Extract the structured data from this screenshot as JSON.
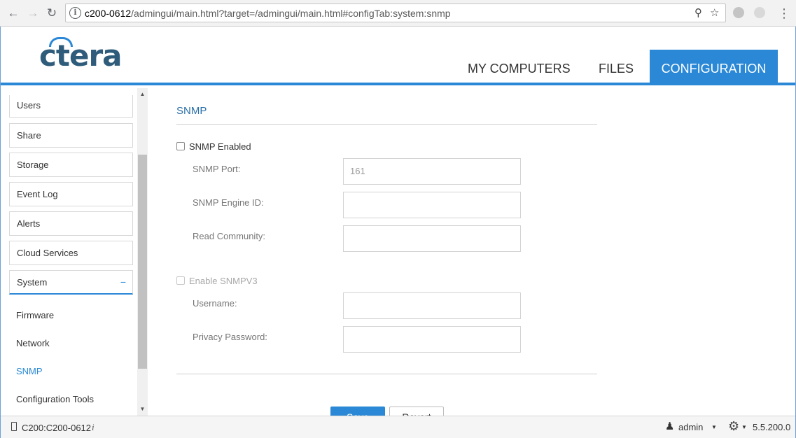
{
  "browser": {
    "url_host": "c200-0612",
    "url_path": "/admingui/main.html?target=/admingui/main.html#configTab:system:snmp"
  },
  "app": {
    "logo_text": "ctera",
    "tabs": [
      "MY COMPUTERS",
      "FILES",
      "CONFIGURATION"
    ],
    "active_tab": "CONFIGURATION",
    "accent_color": "#2a88d6"
  },
  "sidebar": {
    "items": [
      "Users",
      "Share",
      "Storage",
      "Event Log",
      "Alerts",
      "Cloud Services",
      "System"
    ],
    "system_collapse": "−",
    "sub_items": [
      "Firmware",
      "Network",
      "SNMP",
      "Configuration Tools"
    ],
    "active_sub": "SNMP"
  },
  "content": {
    "title": "SNMP",
    "snmp_enabled_label": "SNMP Enabled",
    "snmp_port_label": "SNMP Port:",
    "snmp_port_value": "161",
    "engine_id_label": "SNMP Engine ID:",
    "read_community_label": "Read Community:",
    "enable_v3_label": "Enable SNMPV3",
    "username_label": "Username:",
    "privacy_password_label": "Privacy Password:",
    "save_label": "Save",
    "revert_label": "Revert"
  },
  "footer": {
    "device": "C200:C200-0612",
    "info_glyph": "i",
    "user": "admin",
    "version": "5.5.200.0"
  }
}
